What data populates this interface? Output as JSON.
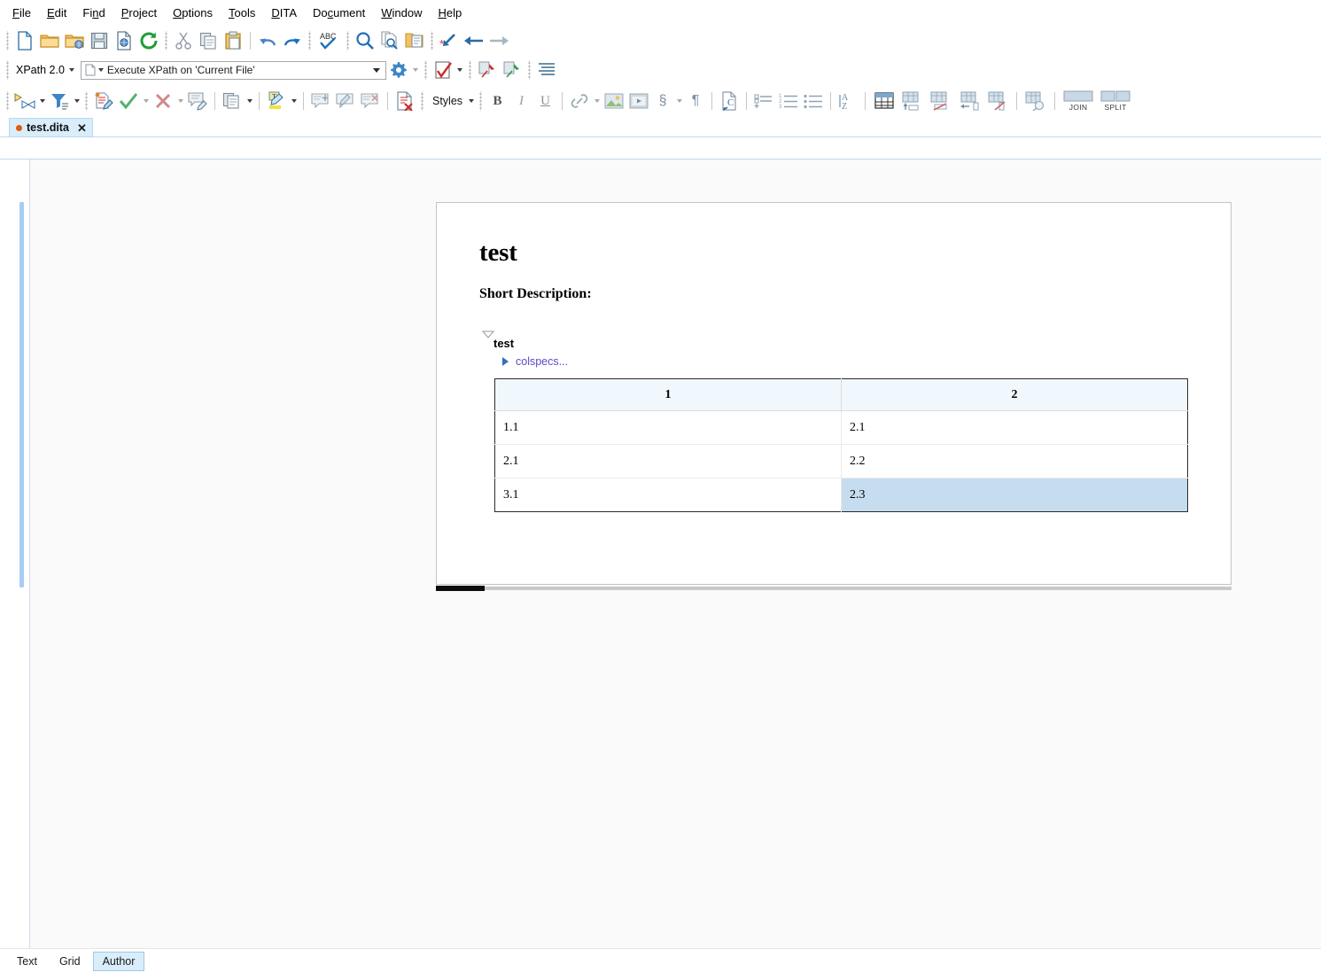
{
  "menubar": {
    "items": [
      {
        "label": "File",
        "mnemonic": "F"
      },
      {
        "label": "Edit",
        "mnemonic": "E"
      },
      {
        "label": "Find",
        "mnemonic": "n"
      },
      {
        "label": "Project",
        "mnemonic": "P"
      },
      {
        "label": "Options",
        "mnemonic": "O"
      },
      {
        "label": "Tools",
        "mnemonic": "T"
      },
      {
        "label": "DITA",
        "mnemonic": "D"
      },
      {
        "label": "Document",
        "mnemonic": "c"
      },
      {
        "label": "Window",
        "mnemonic": "W"
      },
      {
        "label": "Help",
        "mnemonic": "H"
      }
    ]
  },
  "toolbar_main": {
    "icons": [
      "new-file-icon",
      "open-folder-icon",
      "open-url-folder-icon",
      "save-icon",
      "save-as-web-icon",
      "reload-icon",
      "cut-icon",
      "copy-icon",
      "paste-icon",
      "undo-icon",
      "redo-icon",
      "spell-check-icon",
      "find-replace-icon",
      "find-in-document-icon",
      "find-in-folder-icon",
      "go-to-last-edit-icon",
      "navigate-back-icon",
      "navigate-forward-icon"
    ]
  },
  "xpath_bar": {
    "version_label": "XPath 2.0",
    "scope_text_prefix": "Execute XPath on ",
    "scope_text_value": "'Current File'",
    "scope_full": "Execute XPath on  'Current File'",
    "icons": [
      "xpath-file-icon",
      "xpath-settings-icon",
      "validate-icon",
      "pin-red-icon",
      "pin-green-icon",
      "format-indent-icon"
    ]
  },
  "toolbar_review": {
    "icons": [
      "track-changes-icon",
      "filter-changes-icon",
      "edit-document-icon",
      "accept-change-icon",
      "reject-change-icon",
      "manage-comment-icon",
      "copy-style-icon",
      "highlight-icon",
      "add-comment-icon",
      "edit-comment-icon",
      "remove-comment-icon",
      "validate-document-icon"
    ],
    "styles_label": "Styles"
  },
  "toolbar_format": {
    "bold_label": "B",
    "italic_label": "I",
    "underline_label": "U",
    "section_symbol": "§",
    "pilcrow_symbol": "¶",
    "icons": [
      "link-icon",
      "insert-image-icon",
      "insert-media-icon",
      "section-icon",
      "paragraph-icon",
      "insert-character-icon",
      "definition-list-icon",
      "numbered-list-icon",
      "bullet-list-icon",
      "sort-az-icon"
    ]
  },
  "toolbar_table": {
    "icons": [
      "insert-table-icon",
      "insert-row-icon",
      "delete-row-icon",
      "insert-column-icon",
      "delete-column-icon",
      "table-properties-icon"
    ],
    "join_label": "JOIN",
    "split_label": "SPLIT"
  },
  "editor_tabs": {
    "active": {
      "filename": "test.dita",
      "modified": true,
      "close_label": "✕"
    }
  },
  "document": {
    "title": "test",
    "short_description_label": "Short Description:",
    "table_title": "test",
    "colspecs_label": "colspecs...",
    "table": {
      "headers": [
        "1",
        "2"
      ],
      "rows": [
        [
          "1.1",
          "2.1"
        ],
        [
          "2.1",
          "2.2"
        ],
        [
          "3.1",
          "2.3"
        ]
      ],
      "selected_cell": {
        "row": 2,
        "col": 1,
        "value": "2.3"
      }
    }
  },
  "view_tabs": {
    "items": [
      {
        "label": "Text",
        "active": false
      },
      {
        "label": "Grid",
        "active": false
      },
      {
        "label": "Author",
        "active": true
      }
    ]
  },
  "colors": {
    "tab_active_bg": "#d9edfb",
    "selection_bg": "#c6ddf0",
    "table_header_bg": "#f1f8fd",
    "modified_dot": "#e8590c",
    "colspecs_text": "#5b4ec4",
    "fold_bar": "#a8cdf2"
  }
}
